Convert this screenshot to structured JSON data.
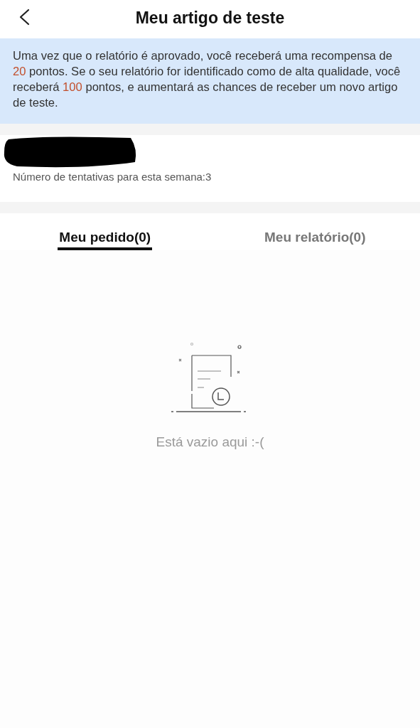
{
  "header": {
    "title": "Meu artigo de teste"
  },
  "notice": {
    "text": "Uma vez que o relatório é aprovado, você receberá uma recompensa de **20** pontos. Se o seu relatório for identificado como de alta qualidade, você receberá **100** pontos, e aumentará as chances de receber um novo artigo de teste."
  },
  "attempts": {
    "text": "Número de tentativas para esta semana:3"
  },
  "tabs": [
    {
      "label": "Meu pedido(0)",
      "selected": true
    },
    {
      "label": "Meu relatório(0)",
      "selected": false
    }
  ],
  "empty_state": {
    "message": "Está vazio aqui :-("
  }
}
